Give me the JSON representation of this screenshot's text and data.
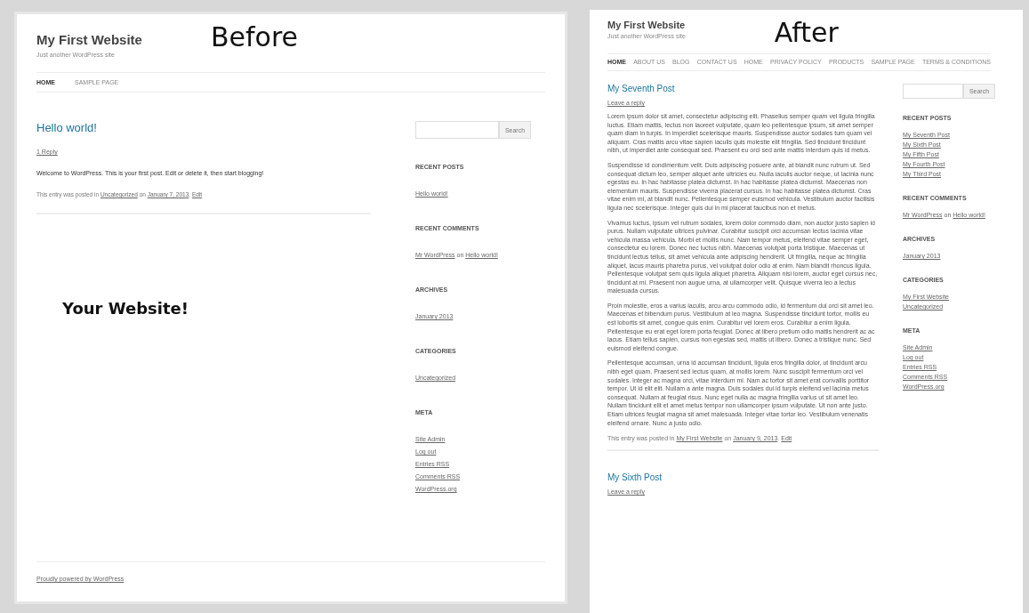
{
  "panels": [
    {
      "kind": "before",
      "caption": "Before",
      "site_title": "My First Website",
      "tagline": "Just another WordPress site",
      "nav": [
        {
          "label": "HOME",
          "selected": true
        },
        {
          "label": "SAMPLE PAGE",
          "selected": false
        }
      ],
      "posts": [
        {
          "title": "Hello world!",
          "reply": "1 Reply",
          "paragraphs": [
            "Welcome to WordPress. This is your first post. Edit or delete it, then start blogging!"
          ],
          "meta": [
            {
              "text": "This entry was posted in ",
              "kind": "text"
            },
            {
              "text": "Uncategorized",
              "kind": "link"
            },
            {
              "text": " on ",
              "kind": "text"
            },
            {
              "text": "January 7, 2013",
              "kind": "link"
            },
            {
              "text": ". ",
              "kind": "text"
            },
            {
              "text": "Edit",
              "kind": "link"
            }
          ]
        }
      ],
      "overlay_text": "Your Website!",
      "sidebar": {
        "search_button": "Search",
        "widgets": [
          {
            "heading": "RECENT POSTS",
            "items": [
              "Hello world!"
            ]
          },
          {
            "heading": "RECENT COMMENTS",
            "items": [
              [
                {
                  "text": "Mr WordPress",
                  "kind": "link"
                },
                {
                  "text": " on ",
                  "kind": "text"
                },
                {
                  "text": "Hello world!",
                  "kind": "link"
                }
              ]
            ]
          },
          {
            "heading": "ARCHIVES",
            "items": [
              "January 2013"
            ]
          },
          {
            "heading": "CATEGORIES",
            "items": [
              "Uncategorized"
            ]
          },
          {
            "heading": "META",
            "items": [
              "Site Admin",
              "Log out",
              "Entries RSS",
              "Comments RSS",
              "WordPress.org"
            ]
          }
        ]
      },
      "footer": "Proudly powered by WordPress"
    },
    {
      "kind": "after",
      "caption": "After",
      "site_title": "My First Website",
      "tagline": "Just another WordPress site",
      "nav": [
        {
          "label": "HOME",
          "selected": true
        },
        {
          "label": "ABOUT US",
          "selected": false
        },
        {
          "label": "BLOG",
          "selected": false
        },
        {
          "label": "CONTACT US",
          "selected": false
        },
        {
          "label": "HOME",
          "selected": false
        },
        {
          "label": "PRIVACY POLICY",
          "selected": false
        },
        {
          "label": "PRODUCTS",
          "selected": false
        },
        {
          "label": "SAMPLE PAGE",
          "selected": false
        },
        {
          "label": "TERMS & CONDITIONS",
          "selected": false
        }
      ],
      "posts": [
        {
          "title": "My Seventh Post",
          "reply": "Leave a reply",
          "paragraphs": [
            "Lorem ipsum dolor sit amet, consectetur adipiscing elit. Phasellus semper quam vel ligula fringilla luctus. Etiam mattis, lectus non laoreet vulputate, quam leo pellentesque ipsum, sit amet semper quam diam in turpis. In imperdiet scelerisque mauris. Suspendisse auctor sodales tum quam vel aliquam. Cras mattis arcu vitae sapien iaculis quis molestie elit fringilla. Sed tincidunt tincidunt nibh, ut imperdiet ante consequat sed. Praesent eu orci sed ante mattis interdum quis id metus.",
            "Suspendisse id condimentum velit. Duis adipiscing posuere ante, at blandit nunc rutrum ut. Sed consequat dictum leo, semper aliquet ante ultricies eu. Nulla iaculis auctor neque, ut lacinia nunc egestas eu. In hac habitasse platea dictumst. In hac habitasse platea dictumst. Maecenas non elementum mauris. Suspendisse viverra placerat cursus. In hac habitasse platea dictumst. Cras vitae enim mi, at blandit nunc. Pellentesque semper euismod vehicula. Vestibulum auctor facilisis ligula nec scelerisque. Integer quis dui in mi placerat faucibus non et metus.",
            "Vivamus luctus, ipsum vel rutrum sodales, lorem dolor commodo diam, non auctor justo sapien id purus. Nullam vulputate ultrices pulvinar. Curabitur suscipit orci accumsan lectus lacinia vitae vehicula massa vehicula. Morbi et mollis nunc. Nam tempor metus, eleifend vitae semper eget, consectetur eu lorem. Donec nec luctus nibh. Maecenas volutpat porta tristique. Maecenas ut tincidunt lectus tellus, sit amet vehicula ante adipiscing hendrerit. Ut fringilla, neque ac fringilla aliquet, lacus mauris pharetra purus, vel volutpat dolor odio at enim. Nam blandit rhoncus ligula. Pellentesque volutpat sem quis ligula aliquet pharetra. Aliquam nisi lorem, auctor eget cursus nec, tincidunt at mi. Praesent non augue urna, at ullamcorper velit. Quisque viverra leo a lectus malesuada cursus.",
            "Proin molestie, eros a varius iaculis, arcu arcu commodo odio, id fermentum dui orci sit amet leo. Maecenas et bibendum purus. Vestibulum at leo magna. Suspendisse tincidunt tortor, mollis eu est lobortis sit amet, congue quis enim. Curabitur vel lorem eros. Curabitur a enim ligula. Pellentesque eu erat eget lorem porta feugiat. Donec at libero pretium odio mattis hendrerit ac ac lacus. Etiam tellus sapien, cursus non egestas sed, mattis ut libero. Donec a tristique nunc. Sed euismod eleifend congue.",
            "Pellentesque accumsan, urna id accumsan tincidunt, ligula eros fringilla dolor, ut tincidunt arcu nibh eget quam. Praesent sed lectus quam, at mollis lorem. Nunc suscipit fermentum orci vel sodales. Integer ac magna orci, vitae interdum mi. Nam ac tortor sit amet erat convallis porttitor tempor. Ut id elit elit. Nullam a ante magna. Duis sodales dui id turpis eleifend vel lacinia metus consequat. Nullam at feugiat risus. Nunc eget nulla ac magna fringilla varius ut sit amet leo. Nullam tincidunt elit et amet metus tempor non ullamcorper ipsum vulputate. Ut non ante justo. Etiam ultrices feugiat magna sit amet malesuada. Integer vitae tortor leo. Vestibulum venenatis eleifend ornare. Nunc a justo odio."
          ],
          "meta": [
            {
              "text": "This entry was posted in ",
              "kind": "text"
            },
            {
              "text": "My First Website",
              "kind": "link"
            },
            {
              "text": " on ",
              "kind": "text"
            },
            {
              "text": "January 9, 2013",
              "kind": "link"
            },
            {
              "text": ". ",
              "kind": "text"
            },
            {
              "text": "Edit",
              "kind": "link"
            }
          ]
        },
        {
          "title": "My Sixth Post",
          "reply": "Leave a reply"
        }
      ],
      "sidebar": {
        "search_button": "Search",
        "widgets": [
          {
            "heading": "RECENT POSTS",
            "items": [
              "My Seventh Post",
              "My Sixth Post",
              "My Fifth Post",
              "My Fourth Post",
              "My Third Post"
            ]
          },
          {
            "heading": "RECENT COMMENTS",
            "items": [
              [
                {
                  "text": "Mr WordPress",
                  "kind": "link"
                },
                {
                  "text": " on ",
                  "kind": "text"
                },
                {
                  "text": "Hello world!",
                  "kind": "link"
                }
              ]
            ]
          },
          {
            "heading": "ARCHIVES",
            "items": [
              "January 2013"
            ]
          },
          {
            "heading": "CATEGORIES",
            "items": [
              "My First Website",
              "Uncategorized"
            ]
          },
          {
            "heading": "META",
            "items": [
              "Site Admin",
              "Log out",
              "Entries RSS",
              "Comments RSS",
              "WordPress.org"
            ]
          }
        ]
      }
    }
  ]
}
